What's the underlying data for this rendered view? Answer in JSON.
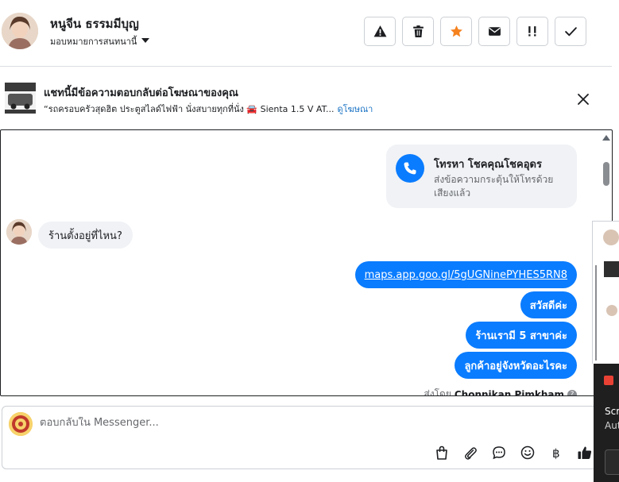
{
  "header": {
    "contact_name": "หนูจีน ธรรมมีบุญ",
    "assign_label": "มอบหมายการสนทนานี้",
    "action_icons": [
      "warning-icon",
      "trash-icon",
      "star-icon",
      "mail-icon",
      "priority-icon",
      "check-icon"
    ],
    "star_color": "#f5821f"
  },
  "ad_banner": {
    "title": "แชทนี้มีข้อความตอบกลับต่อโฆษณาของคุณ",
    "description": "“รถครอบครัวสุดฮิต ประตูสไลด์ไฟฟ้า นั่งสบายทุกที่นั่ง 🚘 Sienta 1.5 V AT...",
    "link": "ดูโฆษณา"
  },
  "chat": {
    "call_card": {
      "title": "โทรหา โชคคุณโชคอุดร",
      "subtitle": "ส่งข้อความกระตุ้นให้โทรด้วยเสียงแล้ว"
    },
    "incoming": [
      "ร้านตั้งอยู่ที่ไหน?"
    ],
    "outgoing": [
      "maps.app.goo.gl/5gUGNinePYHES5RN8",
      "สวัสดีค่ะ",
      "ร้านเรามี 5 สาขาค่ะ",
      "ลูกค้าอยู่จังหวัดอะไรคะ"
    ],
    "sent_by_prefix": "ส่งโดย",
    "sent_by_name": "Chonnikan Pimkham",
    "bubble_color": "#0a7cff"
  },
  "composer": {
    "placeholder": "ตอบกลับใน Messenger...",
    "tool_icons": [
      "bag-icon",
      "paperclip-icon",
      "chat-icon",
      "emoji-icon",
      "baht-icon",
      "thumbs-up-icon"
    ]
  },
  "toast": {
    "line1": "Scr",
    "line2": "Aut"
  }
}
